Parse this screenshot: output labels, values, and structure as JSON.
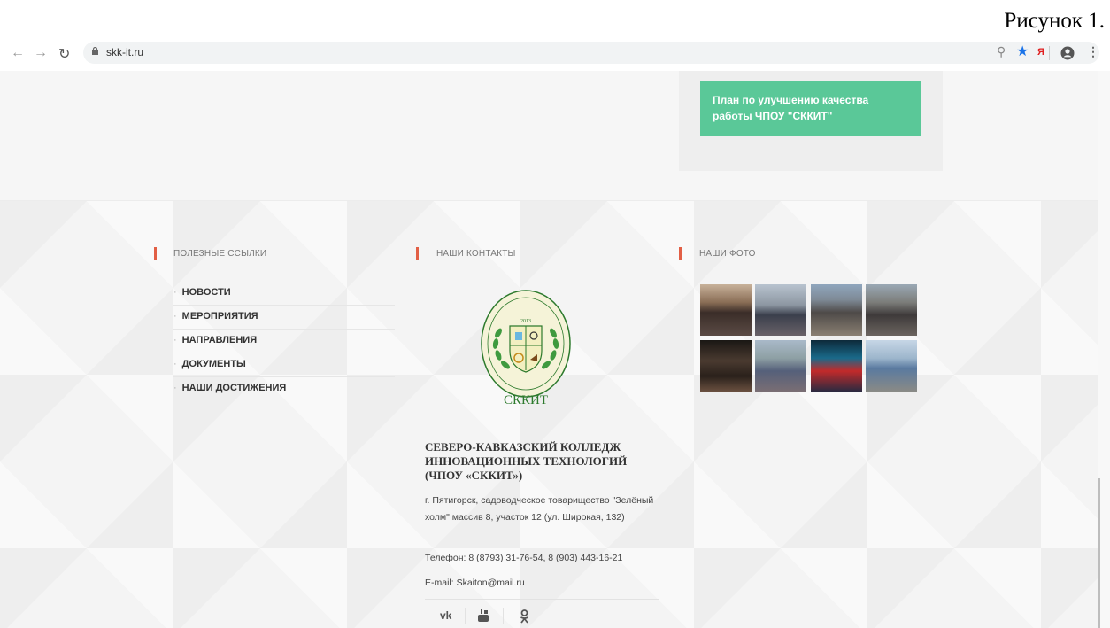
{
  "caption": "Рисунок 1.",
  "browser": {
    "url": "skk-it.ru",
    "icons": [
      "back-arrow-icon",
      "forward-arrow-icon",
      "reload-icon",
      "lock-icon",
      "zoom-icon",
      "bookmark-star-icon",
      "yandex-icon",
      "account-icon",
      "menu-dots-icon"
    ],
    "yandex_label": "Я"
  },
  "top_button": {
    "label": "План по улучшению качества работы ЧПОУ \"СККИТ\"",
    "color": "#5ac898"
  },
  "footer": {
    "links_title": "ПОЛЕЗНЫЕ ССЫЛКИ",
    "links": [
      "НОВОСТИ",
      "МЕРОПРИЯТИЯ",
      "НАПРАВЛЕНИЯ",
      "ДОКУМЕНТЫ",
      "НАШИ ДОСТИЖЕНИЯ"
    ],
    "contacts_title": "НАШИ КОНТАКТЫ",
    "org_name": "СЕВЕРО-КАВКАЗСКИЙ КОЛЛЕДЖ ИННОВАЦИОННЫХ ТЕХНОЛОГИЙ (ЧПОУ «СККИТ»)",
    "logo": {
      "text": "СККИТ",
      "year": "2013"
    },
    "address": "г. Пятигорск, садоводческое товарищество \"Зелёный холм\" массив 8, участок 12 (ул. Широкая, 132)",
    "phone": "Телефон: 8 (8793) 31-76-54, 8 (903) 443-16-21",
    "email": "E-mail: Skaiton@mail.ru",
    "social": [
      "vk-icon",
      "youtube-icon",
      "odnoklassniki-icon"
    ],
    "photos_title": "НАШИ ФОТО"
  },
  "colors": {
    "accent": "#e25f45",
    "green": "#5ac898"
  }
}
